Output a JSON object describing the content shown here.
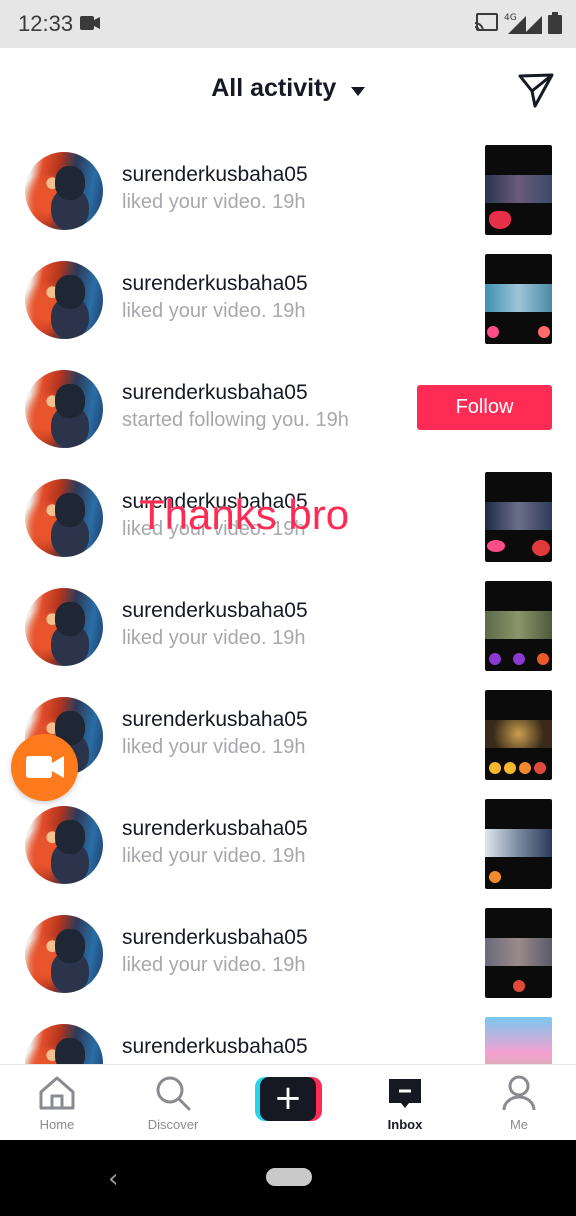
{
  "status_bar": {
    "time": "12:33",
    "icons": [
      "video-record-icon",
      "cast-icon",
      "4g-signal-icon",
      "signal-icon",
      "battery-icon"
    ]
  },
  "header": {
    "title": "All activity",
    "icons": [
      "dropdown-caret-icon",
      "send-message-icon"
    ]
  },
  "activities": [
    {
      "username": "surenderkusbaha05",
      "action": "liked your video.",
      "time": "19h",
      "type": "video"
    },
    {
      "username": "surenderkusbaha05",
      "action": "liked your video.",
      "time": "19h",
      "type": "video"
    },
    {
      "username": "surenderkusbaha05",
      "action": "started following you.",
      "time": "19h",
      "type": "follow",
      "button": "Follow"
    },
    {
      "username": "surenderkusbaha05",
      "action": "liked your video.",
      "time": "19h",
      "type": "video"
    },
    {
      "username": "surenderkusbaha05",
      "action": "liked your video.",
      "time": "19h",
      "type": "video"
    },
    {
      "username": "surenderkusbaha05",
      "action": "liked your video.",
      "time": "19h",
      "type": "video"
    },
    {
      "username": "surenderkusbaha05",
      "action": "liked your video.",
      "time": "19h",
      "type": "video"
    },
    {
      "username": "surenderkusbaha05",
      "action": "liked your video.",
      "time": "19h",
      "type": "video"
    },
    {
      "username": "surenderkusbaha05",
      "action": "",
      "time": "",
      "type": "video"
    }
  ],
  "overlay": {
    "text": "Thanks bro"
  },
  "bottom_nav": {
    "items": [
      {
        "label": "Home",
        "icon": "home-icon"
      },
      {
        "label": "Discover",
        "icon": "search-icon"
      },
      {
        "label": "",
        "icon": "plus-icon"
      },
      {
        "label": "Inbox",
        "icon": "inbox-icon",
        "active": true
      },
      {
        "label": "Me",
        "icon": "profile-icon"
      }
    ]
  },
  "colors": {
    "accent": "#fe2c55",
    "cyan": "#20d5ec",
    "fab": "#ff7a1c",
    "muted_text": "#a7a8ad"
  }
}
